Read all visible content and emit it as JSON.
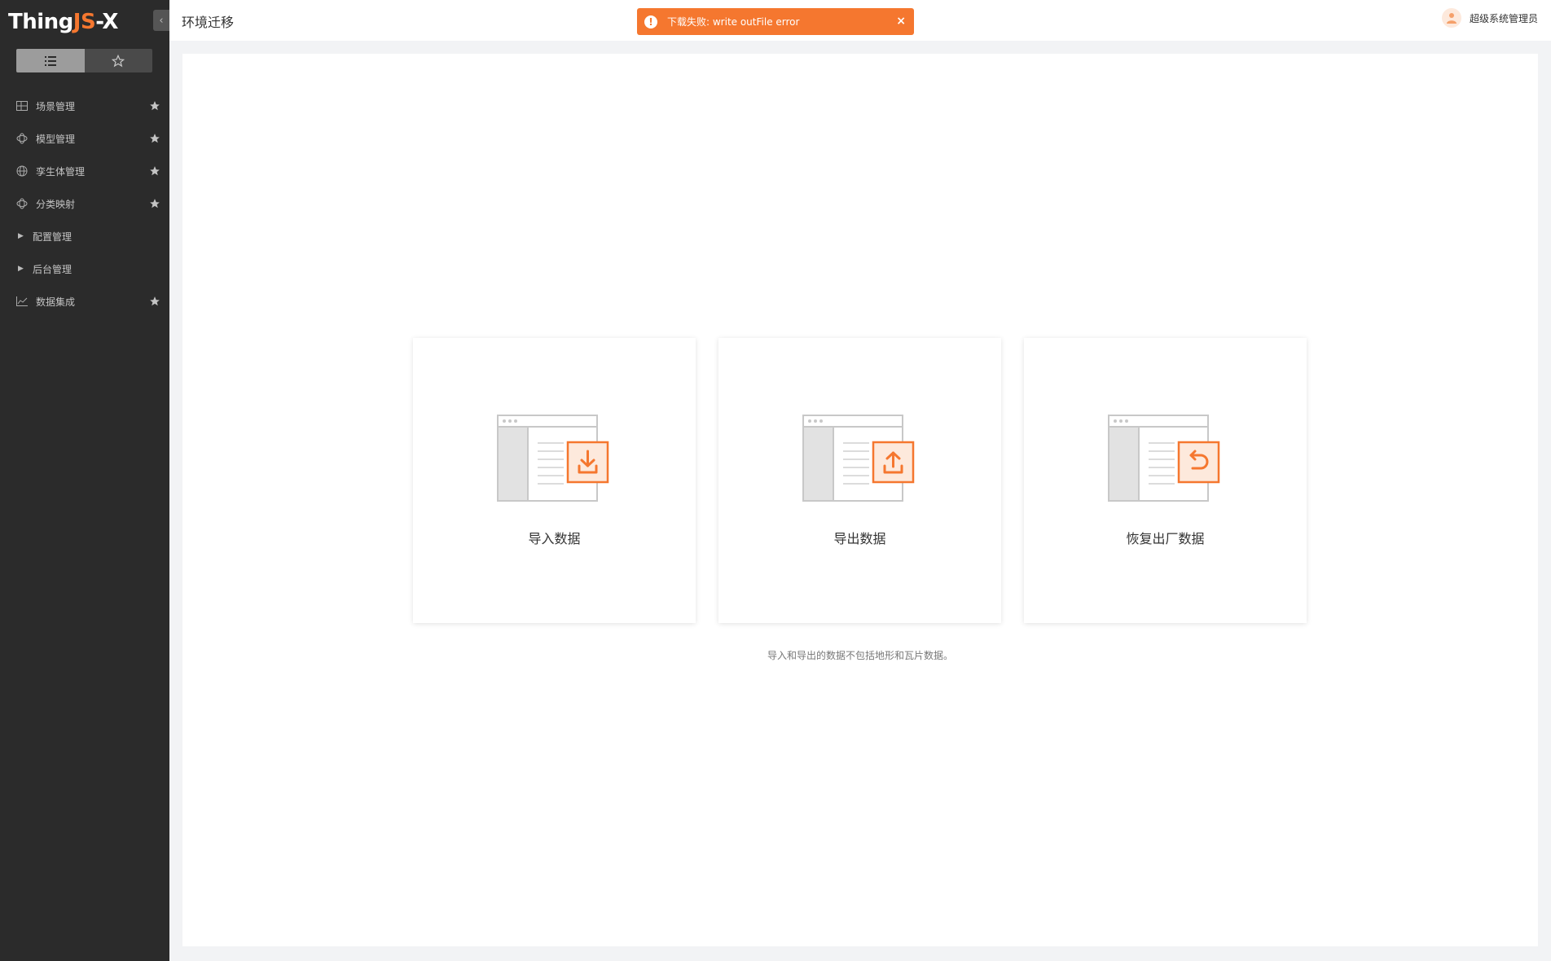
{
  "app": {
    "logo_part1": "Thing",
    "logo_part2": "JS",
    "logo_part3": " -X"
  },
  "sidebar": {
    "collapse_icon": "chevron-left-icon",
    "view_toggle": [
      "list-icon",
      "star-outline-icon"
    ],
    "items": [
      {
        "label": "场景管理",
        "icon": "grid-icon",
        "favorite": true
      },
      {
        "label": "模型管理",
        "icon": "cube-icon",
        "favorite": true
      },
      {
        "label": "孪生体管理",
        "icon": "globe-icon",
        "favorite": true
      },
      {
        "label": "分类映射",
        "icon": "cube-icon",
        "favorite": true
      },
      {
        "label": "配置管理",
        "icon": "caret-right-icon",
        "favorite": false
      },
      {
        "label": "后台管理",
        "icon": "caret-right-icon",
        "favorite": false
      },
      {
        "label": "数据集成",
        "icon": "chart-line-icon",
        "favorite": true
      }
    ]
  },
  "header": {
    "title": "环境迁移",
    "user_name": "超级系统管理员"
  },
  "toast": {
    "message": "下载失败: write outFile error",
    "icon": "exclamation-icon",
    "close_icon": "close-icon"
  },
  "main": {
    "cards": [
      {
        "label": "导入数据",
        "icon": "import-icon"
      },
      {
        "label": "导出数据",
        "icon": "export-icon"
      },
      {
        "label": "恢复出厂数据",
        "icon": "restore-icon"
      }
    ],
    "note": "导入和导出的数据不包括地形和瓦片数据。"
  },
  "colors": {
    "accent": "#f5772f",
    "sidebar_bg": "#2b2b2b"
  }
}
